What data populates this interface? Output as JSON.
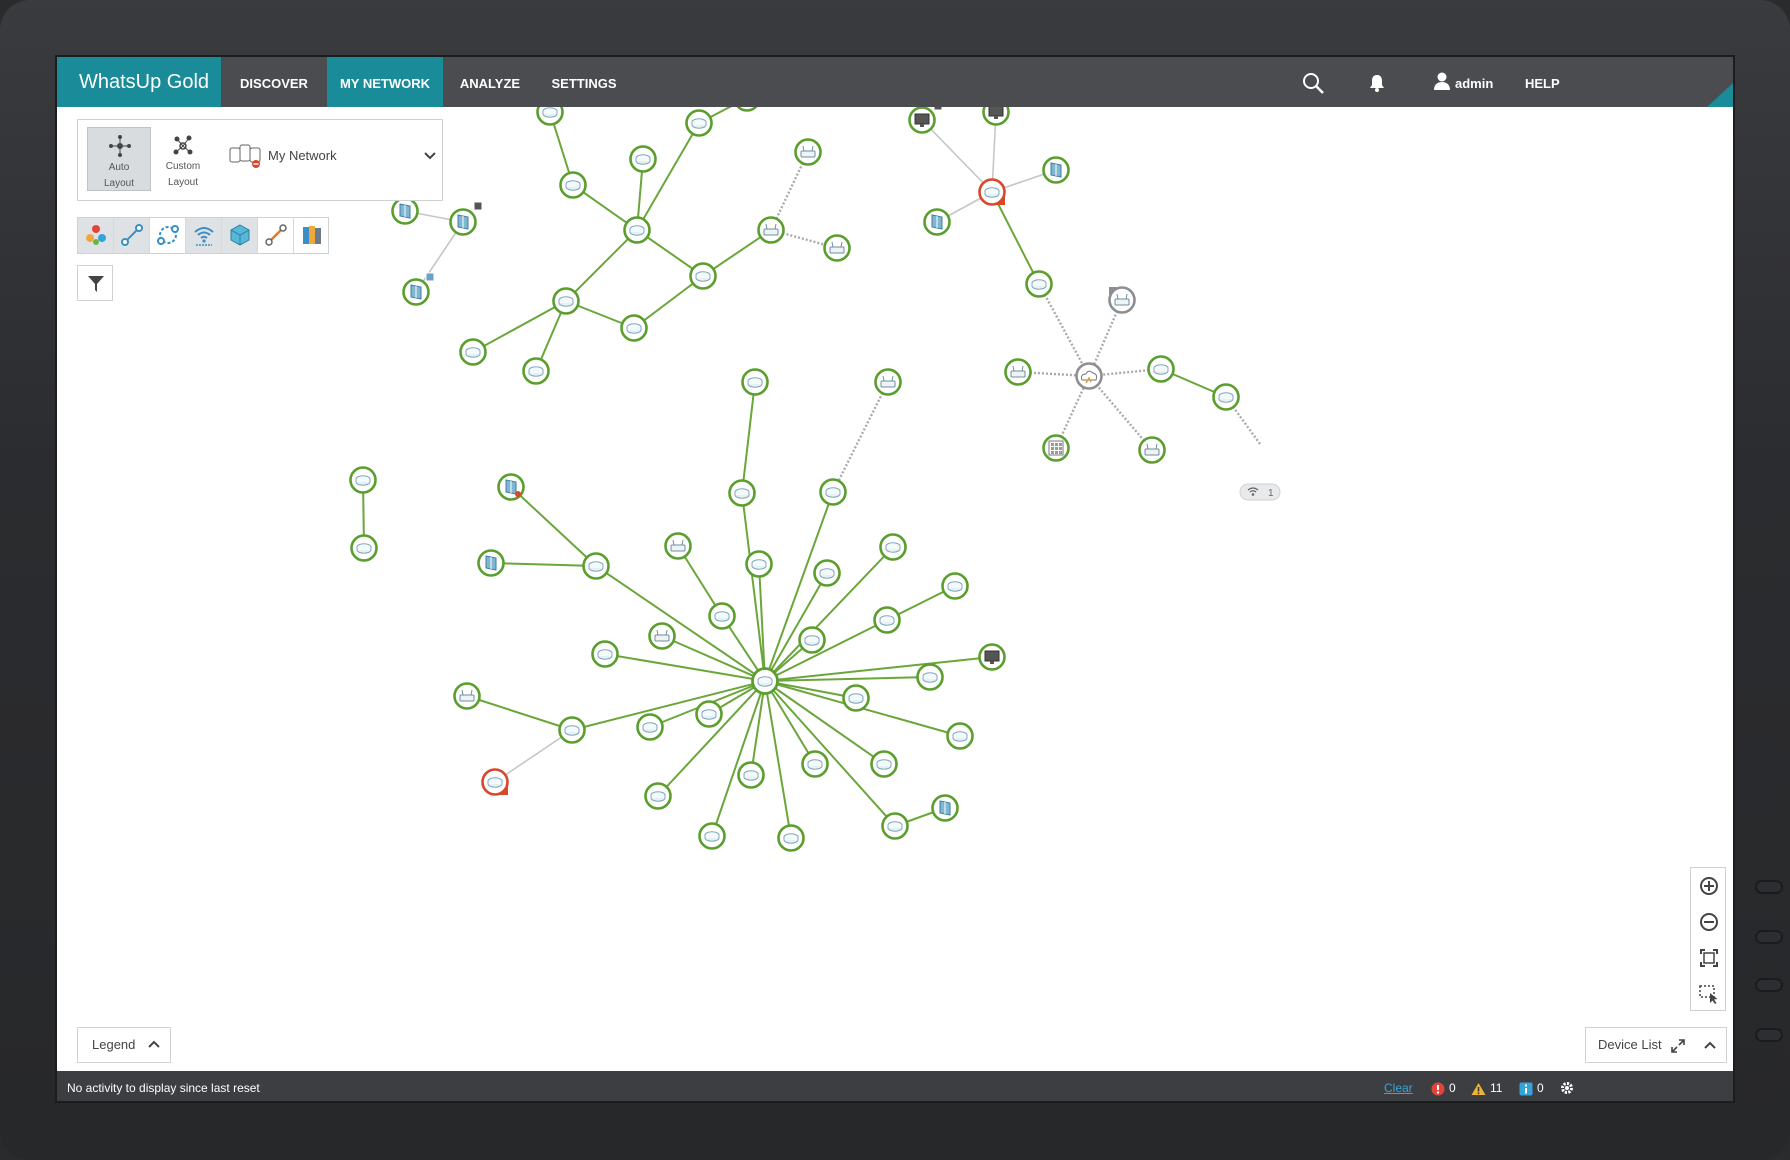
{
  "app": {
    "brand": "WhatsUp Gold"
  },
  "nav": {
    "discover": "DISCOVER",
    "my_network": "MY NETWORK",
    "analyze": "ANALYZE",
    "settings": "SETTINGS"
  },
  "topright": {
    "user": "admin",
    "help": "HELP"
  },
  "layout_panel": {
    "auto_line1": "Auto",
    "auto_line2": "Layout",
    "custom_line1": "Custom",
    "custom_line2": "Layout",
    "network_name": "My Network"
  },
  "toolbar_icons": [
    "device-groups-icon",
    "connect-icon",
    "layer2-icon",
    "wireless-icon",
    "virtual-icon",
    "path-icon",
    "storage-icon"
  ],
  "legend": {
    "label": "Legend"
  },
  "device_list": {
    "label": "Device List"
  },
  "statusbar": {
    "message": "No activity to display since last reset",
    "clear": "Clear",
    "errors": "0",
    "warnings": "11",
    "info": "0"
  },
  "wireless_badge": {
    "count": "1"
  },
  "colors": {
    "brand": "#1a8b99",
    "node_up": "#5a9e2d",
    "node_down": "#d9472b",
    "link_unknown": "#b8babc"
  }
}
